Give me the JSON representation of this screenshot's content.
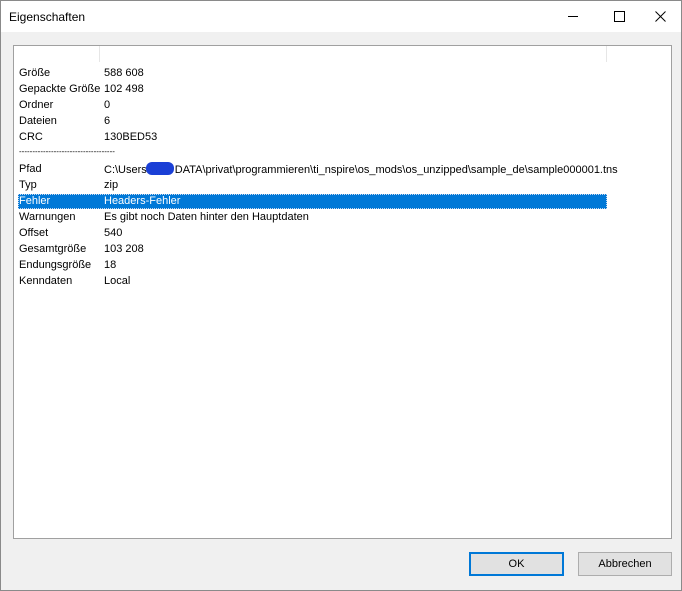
{
  "window": {
    "title": "Eigenschaften"
  },
  "icons": {
    "minimize": "minimize-icon",
    "maximize": "maximize-icon",
    "close": "close-icon"
  },
  "properties_group1": [
    {
      "key": "Größe",
      "value": "588 608"
    },
    {
      "key": "Gepackte Größe",
      "value": "102 498"
    },
    {
      "key": "Ordner",
      "value": "0"
    },
    {
      "key": "Dateien",
      "value": "6"
    },
    {
      "key": "CRC",
      "value": "130BED53"
    }
  ],
  "separator": "------------------------------------",
  "path": {
    "key": "Pfad",
    "value_prefix": "C:\\Users",
    "value_suffix": "DATA\\privat\\programmieren\\ti_nspire\\os_mods\\os_unzipped\\sample_de\\sample000001.tns"
  },
  "properties_group2": [
    {
      "key": "Typ",
      "value": "zip"
    },
    {
      "key": "Fehler",
      "value": "Headers-Fehler",
      "selected": true
    },
    {
      "key": "Warnungen",
      "value": "Es gibt noch Daten hinter den Hauptdaten"
    },
    {
      "key": "Offset",
      "value": "540"
    },
    {
      "key": "Gesamtgröße",
      "value": "103 208"
    },
    {
      "key": "Endungsgröße",
      "value": "18"
    },
    {
      "key": "Kenndaten",
      "value": "Local"
    }
  ],
  "buttons": {
    "ok": "OK",
    "cancel": "Abbrechen"
  },
  "colors": {
    "selection": "#0078d7",
    "redaction": "#1a3fd6"
  }
}
